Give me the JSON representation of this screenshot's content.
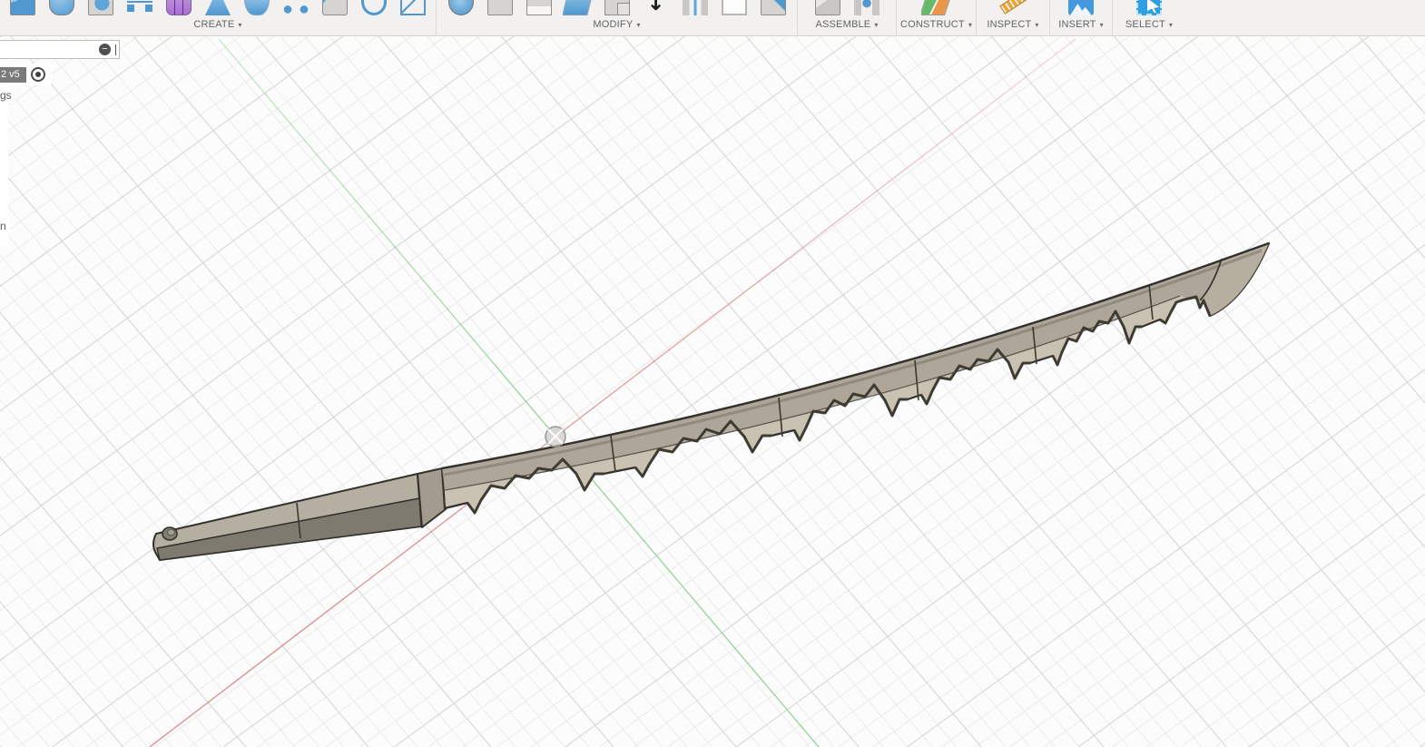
{
  "toolbar": {
    "caret": "▾",
    "groups": [
      {
        "label": "CREATE",
        "icons": [
          "box-icon",
          "revolve-icon",
          "sphere-icon",
          "coil-icon",
          "form-icon",
          "loft-icon",
          "pipe-icon",
          "pattern-icon",
          "patch-icon",
          "torus-icon",
          "frame-icon"
        ]
      },
      {
        "label": "MODIFY",
        "icons": [
          "press-pull-icon",
          "fillet-icon",
          "shell-icon",
          "draft-icon",
          "scale-icon",
          "move-icon",
          "align-icon",
          "delete-icon",
          "replace-face-icon"
        ]
      },
      {
        "label": "ASSEMBLE",
        "icons": [
          "new-component-icon",
          "joint-icon"
        ]
      },
      {
        "label": "CONSTRUCT",
        "icons": [
          "construction-plane-icon"
        ]
      },
      {
        "label": "INSPECT",
        "icons": [
          "measure-icon"
        ]
      },
      {
        "label": "INSERT",
        "icons": [
          "insert-image-icon"
        ]
      },
      {
        "label": "SELECT",
        "icons": [
          "select-icon"
        ]
      }
    ]
  },
  "browser": {
    "search": {
      "value": "",
      "placeholder": "",
      "clear_glyph": "−"
    },
    "doc_chip": "2 v5",
    "fragments": {
      "settings": "gs",
      "origin": "n"
    }
  },
  "viewport": {
    "origin_marker": "origin-point",
    "axes": {
      "x_axis_color": "#d98080",
      "y_axis_color": "#85c785"
    }
  },
  "colors": {
    "toolbar_bg": "#f2f1f0",
    "toolbar_label": "#636363",
    "viewport_bg": "#fcfcfc",
    "grid_minor": "#ebebeb",
    "grid_major": "#d7d7d9",
    "axis_red": "#d98080",
    "axis_green": "#85c785",
    "blade_face": "#c9c2b2",
    "blade_upper": "#a8a194",
    "blade_tip": "#b6afa0",
    "blade_side": "#7e7a6f",
    "blade_outline": "#33312c",
    "select_blue": "#2ea0e0"
  }
}
